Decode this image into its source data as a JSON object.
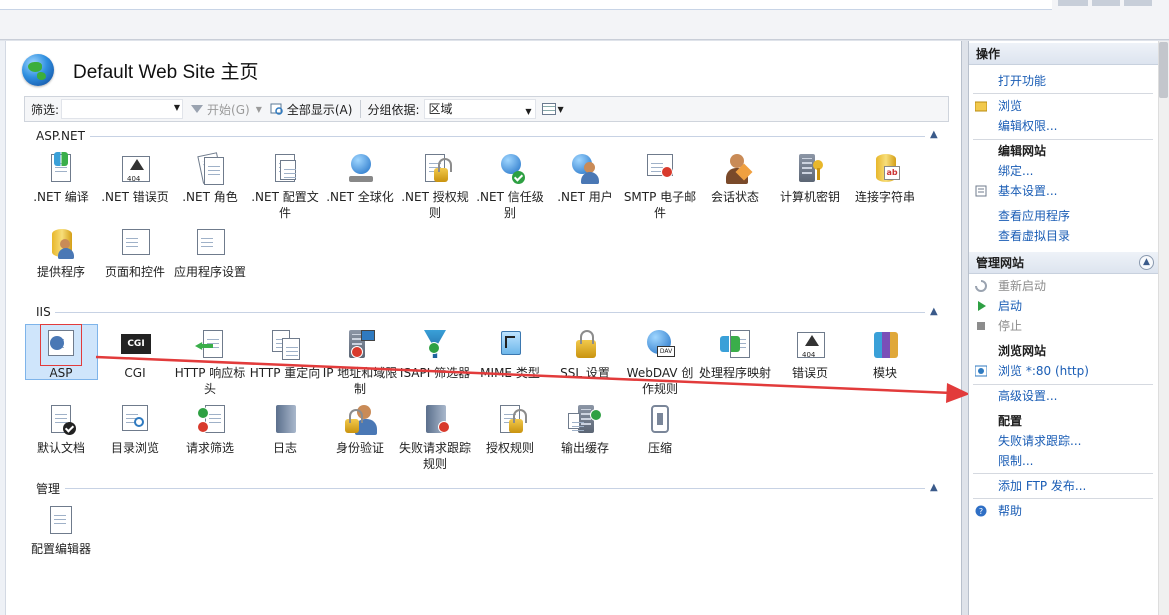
{
  "header": {
    "title": "Default Web Site 主页"
  },
  "toolbar": {
    "filter_label": "筛选:",
    "start_label": "开始(G)",
    "show_all_label": "全部显示(A)",
    "group_by_label": "分组依据:",
    "group_value": "区域"
  },
  "sections": {
    "aspnet": {
      "title": "ASP.NET",
      "items": [
        ".NET 编译",
        ".NET 错误页",
        ".NET 角色",
        ".NET 配置文件",
        ".NET 全球化",
        ".NET 授权规则",
        ".NET 信任级别",
        ".NET 用户",
        "SMTP 电子邮件",
        "会话状态",
        "计算机密钥",
        "连接字符串",
        "提供程序",
        "页面和控件",
        "应用程序设置"
      ]
    },
    "iis": {
      "title": "IIS",
      "items": [
        "ASP",
        "CGI",
        "HTTP 响应标头",
        "HTTP 重定向",
        "IP 地址和域限制",
        "ISAPI 筛选器",
        "MIME 类型",
        "SSL 设置",
        "WebDAV 创作规则",
        "处理程序映射",
        "错误页",
        "模块",
        "默认文档",
        "目录浏览",
        "请求筛选",
        "日志",
        "身份验证",
        "失败请求跟踪规则",
        "授权规则",
        "输出缓存",
        "压缩"
      ]
    },
    "management": {
      "title": "管理",
      "items": [
        "配置编辑器"
      ]
    }
  },
  "actions": {
    "title": "操作",
    "open_feature": "打开功能",
    "browse": "浏览",
    "edit_permissions": "编辑权限...",
    "edit_site_title": "编辑网站",
    "bindings": "绑定...",
    "basic_settings": "基本设置...",
    "view_apps": "查看应用程序",
    "view_vdirs": "查看虚拟目录",
    "manage_site_title": "管理网站",
    "restart": "重新启动",
    "start": "启动",
    "stop": "停止",
    "browse_site_title": "浏览网站",
    "browse_port": "浏览 *:80 (http)",
    "advanced_settings": "高级设置...",
    "config_title": "配置",
    "failed_request_tracing": "失败请求跟踪...",
    "limits": "限制...",
    "add_ftp": "添加 FTP 发布...",
    "help": "帮助"
  },
  "colors": {
    "link": "#1a5db5",
    "annotation": "#e23b3b",
    "selection": "#cfe5fb"
  }
}
